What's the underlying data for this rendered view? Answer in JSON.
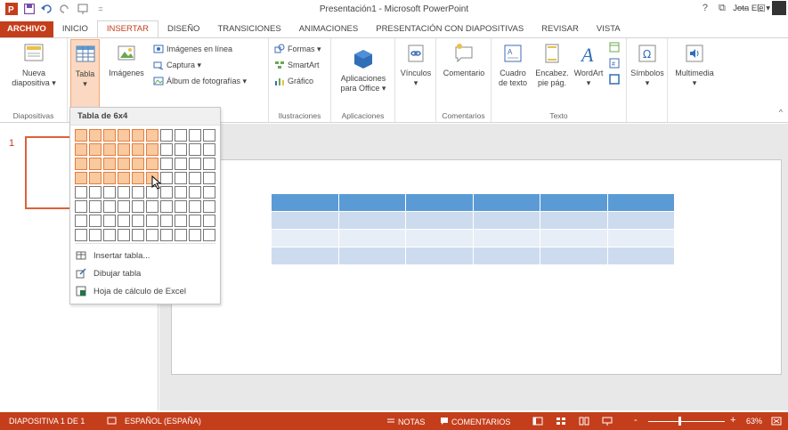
{
  "window": {
    "title": "Presentación1 - Microsoft PowerPoint",
    "help": "?",
    "restore_glyph": "⧉",
    "minimize_glyph": "—",
    "maximize_glyph": "☐",
    "close_glyph": "✕"
  },
  "quick_access": {
    "icons": [
      "powerpoint-logo-icon",
      "save-icon",
      "undo-icon",
      "redo-icon",
      "start-slideshow-icon",
      "customize-qat-icon"
    ]
  },
  "tabs": [
    {
      "label": "ARCHIVO"
    },
    {
      "label": "INICIO"
    },
    {
      "label": "INSERTAR"
    },
    {
      "label": "DISEÑO"
    },
    {
      "label": "TRANSICIONES"
    },
    {
      "label": "ANIMACIONES"
    },
    {
      "label": "PRESENTACIÓN CON DIAPOSITIVAS"
    },
    {
      "label": "REVISAR"
    },
    {
      "label": "VISTA"
    }
  ],
  "active_tab": "INSERTAR",
  "user": {
    "name": "Jota Ele ▾"
  },
  "ribbon": {
    "diapositivas": {
      "label": "Diapositivas",
      "nueva_line1": "Nueva",
      "nueva_line2": "diapositiva ▾"
    },
    "tablas": {
      "tabla": "Tabla",
      "tabla_arrow": "▾"
    },
    "imagenes": {
      "imagenes": "Imágenes",
      "en_linea": "Imágenes en línea",
      "captura": "Captura ▾",
      "album": "Álbum de fotografías ▾"
    },
    "ilustraciones": {
      "label": "Ilustraciones",
      "formas": "Formas ▾",
      "smartart": "SmartArt",
      "grafico": "Gráfico"
    },
    "aplicaciones": {
      "label": "Aplicaciones",
      "line1": "Aplicaciones",
      "line2": "para Office ▾"
    },
    "vinculos": {
      "label": "Vínculos",
      "arrow": "▾"
    },
    "comentarios": {
      "label": "Comentarios",
      "comentario": "Comentario"
    },
    "texto": {
      "label": "Texto",
      "cuadro1": "Cuadro",
      "cuadro2": "de texto",
      "encabez1": "Encabez.",
      "encabez2": "pie pág.",
      "wordart": "WordArt",
      "wordart_arrow": "▾"
    },
    "simbolos": {
      "label": "Símbolos",
      "arrow": "▾"
    },
    "multimedia": {
      "label": "Multimedia",
      "arrow": "▾"
    },
    "collapse": "^"
  },
  "table_menu": {
    "title": "Tabla de 6x4",
    "grid_columns": 10,
    "grid_rows": 8,
    "selected_columns": 6,
    "selected_rows": 4,
    "items": [
      {
        "label": "Insertar tabla..."
      },
      {
        "label": "Dibujar tabla"
      },
      {
        "label": "Hoja de cálculo de Excel"
      }
    ]
  },
  "slides": {
    "current_number": "1"
  },
  "statusbar": {
    "slide_info": "DIAPOSITIVA 1 DE 1",
    "language": "ESPAÑOL (ESPAÑA)",
    "notes": "NOTAS",
    "comments": "COMENTARIOS",
    "zoom_minus": "-",
    "zoom_plus": "+",
    "zoom": "63%"
  },
  "colors": {
    "accent": "#c43e1c",
    "table_header": "#5b9bd5",
    "grid_selected": "#f9c9a0"
  }
}
